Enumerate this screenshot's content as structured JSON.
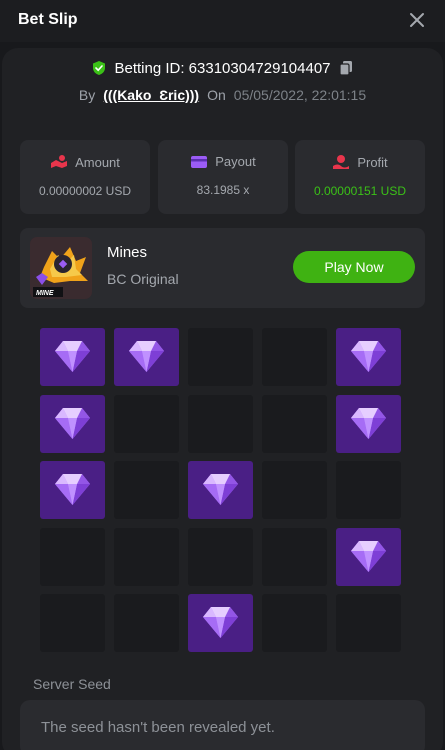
{
  "header": {
    "title": "Bet Slip"
  },
  "bet": {
    "id_label": "Betting ID: 63310304729104407",
    "by_label": "By",
    "username": "(((Kako_Ɛric)))",
    "on_label": "On",
    "datetime": "05/05/2022, 22:01:15"
  },
  "stats": {
    "amount": {
      "label": "Amount",
      "value": "0.00000002 USD"
    },
    "payout": {
      "label": "Payout",
      "value": "83.1985 x"
    },
    "profit": {
      "label": "Profit",
      "value": "0.00000151 USD"
    }
  },
  "game": {
    "name": "Mines",
    "subtitle": "BC Original",
    "thumb_text": "MINE",
    "play_label": "Play Now"
  },
  "board": {
    "columns": 5,
    "rows": 5,
    "cells": [
      "gem",
      "gem",
      "empty",
      "empty",
      "gem",
      "gem",
      "empty",
      "empty",
      "empty",
      "gem",
      "gem",
      "empty",
      "gem",
      "empty",
      "empty",
      "empty",
      "empty",
      "empty",
      "empty",
      "gem",
      "empty",
      "empty",
      "gem",
      "empty",
      "empty"
    ]
  },
  "seed": {
    "label": "Server Seed",
    "text": "The seed hasn't been revealed yet."
  },
  "colors": {
    "accent_green": "#3fb212",
    "profit_green": "#3bc117",
    "gem_tile": "#4a1f85",
    "empty_tile": "#1a1b1e"
  },
  "icons": [
    "close-icon",
    "verified-shield-icon",
    "copy-icon",
    "amount-icon",
    "payout-icon",
    "profit-icon",
    "gem-icon"
  ]
}
